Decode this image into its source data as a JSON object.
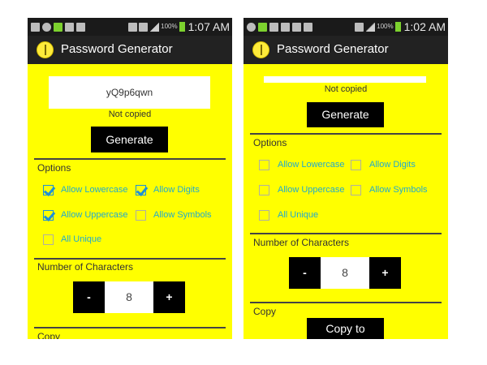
{
  "left": {
    "status": {
      "battery": "100%",
      "time": "1:07 AM"
    },
    "app": {
      "title": "Password Generator"
    },
    "password": "yQ9p6qwn",
    "copy_status": "Not copied",
    "generate_label": "Generate",
    "options": {
      "heading": "Options",
      "lowercase": {
        "label": "Allow Lowercase",
        "checked": true
      },
      "digits": {
        "label": "Allow Digits",
        "checked": true
      },
      "uppercase": {
        "label": "Allow Uppercase",
        "checked": true
      },
      "symbols": {
        "label": "Allow Symbols",
        "checked": false
      },
      "unique": {
        "label": "All Unique",
        "checked": false
      }
    },
    "num_chars": {
      "heading": "Number of Characters",
      "minus": "-",
      "value": "8",
      "plus": "+"
    },
    "copy": {
      "heading": "Copy"
    }
  },
  "right": {
    "status": {
      "battery": "100%",
      "time": "1:02 AM"
    },
    "app": {
      "title": "Password Generator"
    },
    "password": "",
    "copy_status": "Not copied",
    "generate_label": "Generate",
    "options": {
      "heading": "Options",
      "lowercase": {
        "label": "Allow Lowercase",
        "checked": false
      },
      "digits": {
        "label": "Allow Digits",
        "checked": false
      },
      "uppercase": {
        "label": "Allow Uppercase",
        "checked": false
      },
      "symbols": {
        "label": "Allow Symbols",
        "checked": false
      },
      "unique": {
        "label": "All Unique",
        "checked": false
      }
    },
    "num_chars": {
      "heading": "Number of Characters",
      "minus": "-",
      "value": "8",
      "plus": "+"
    },
    "copy": {
      "heading": "Copy",
      "button_label": "Copy to clipboard"
    }
  },
  "colors": {
    "background": "#ffff00",
    "accent_text": "#22aacc",
    "button": "#000000",
    "checkbox": "#1e90d8"
  }
}
